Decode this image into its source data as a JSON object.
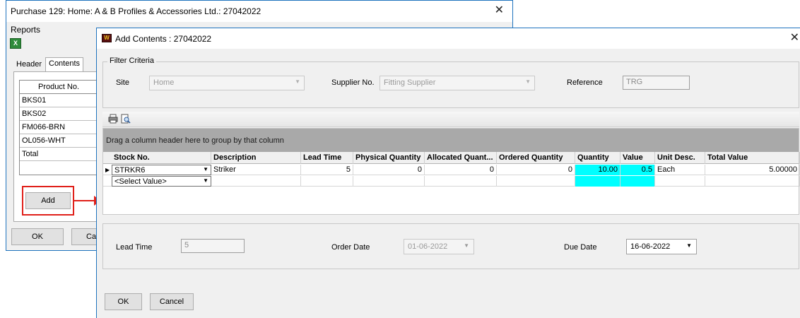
{
  "back_window": {
    "title": "Purchase 129: Home: A & B Profiles & Accessories Ltd.: 27042022",
    "menu_reports": "Reports",
    "tabs": [
      "Header",
      "Contents"
    ],
    "grid_header": "Product No.",
    "products": [
      "BKS01",
      "BKS02",
      "FM066-BRN",
      "OL056-WHT",
      "Total"
    ],
    "add_label": "Add",
    "ok_label": "OK",
    "cancel_label": "Canc"
  },
  "dialog": {
    "title": "Add Contents : 27042022",
    "filter": {
      "legend": "Filter Criteria",
      "site_label": "Site",
      "site_value": "Home",
      "supplier_label": "Supplier No.",
      "supplier_value": "Fitting Supplier",
      "reference_label": "Reference",
      "reference_value": "TRG"
    },
    "group_hint": "Drag a column header here to group by that column",
    "columns": [
      "Stock No.",
      "Description",
      "Lead Time",
      "Physical Quantity",
      "Allocated Quant...",
      "Ordered Quantity",
      "Quantity",
      "Value",
      "Unit Desc.",
      "Total Value"
    ],
    "row1": {
      "stock_no": "STRKR6",
      "description": "Striker",
      "lead_time": "5",
      "physical_qty": "0",
      "allocated_qty": "0",
      "ordered_qty": "0",
      "quantity": "10.00",
      "value": "0.5",
      "unit_desc": "Each",
      "total_value": "5.00000"
    },
    "row2_placeholder": "<Select Value>",
    "lead_time_label": "Lead Time",
    "lead_time_value": "5",
    "order_date_label": "Order Date",
    "order_date_value": "01-06-2022",
    "due_date_label": "Due Date",
    "due_date_value": "16-06-2022",
    "ok_label": "OK",
    "cancel_label": "Cancel"
  },
  "colors": {
    "highlight": "#e0201a",
    "quantity_cell": "#00ffff",
    "window_border": "#1e73be"
  },
  "icons": {
    "excel": "excel-export-icon",
    "print": "print-icon",
    "preview": "print-preview-icon",
    "row_selector": "row-pointer-icon"
  }
}
